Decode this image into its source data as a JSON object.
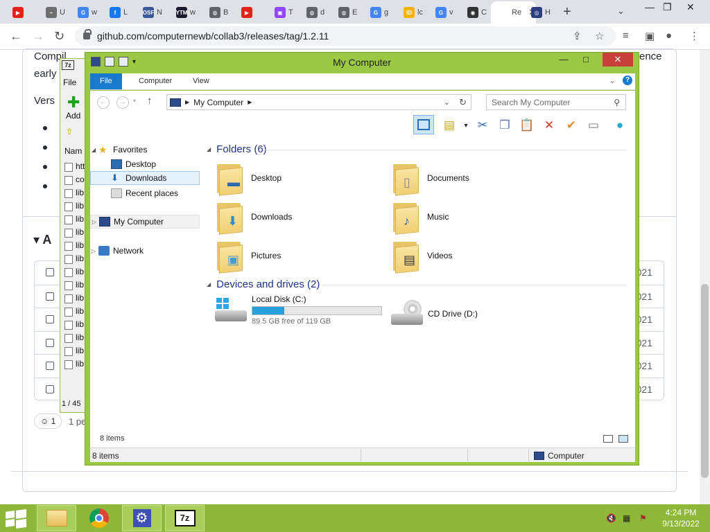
{
  "browser": {
    "tabs": [
      {
        "label": "",
        "color": "#e62117",
        "glyph": "▶"
      },
      {
        "label": "U",
        "color": "#6d6d6d",
        "glyph": "⌁"
      },
      {
        "label": "w",
        "color": "#4285f4",
        "glyph": "G"
      },
      {
        "label": "L",
        "color": "#1877f2",
        "glyph": "f"
      },
      {
        "label": "N",
        "color": "#3b5998",
        "glyph": "OSF"
      },
      {
        "label": "w",
        "color": "#1a1a2e",
        "glyph": "YTM"
      },
      {
        "label": "B",
        "color": "#5f6368",
        "glyph": "◍"
      },
      {
        "label": "",
        "color": "#e62117",
        "glyph": "▶"
      },
      {
        "label": "T",
        "color": "#9146ff",
        "glyph": "▣"
      },
      {
        "label": "d",
        "color": "#5f6368",
        "glyph": "◍"
      },
      {
        "label": "E",
        "color": "#5f6368",
        "glyph": "◍"
      },
      {
        "label": "g",
        "color": "#4285f4",
        "glyph": "G"
      },
      {
        "label": "lc",
        "color": "#f4b400",
        "glyph": "ID"
      },
      {
        "label": "v",
        "color": "#4285f4",
        "glyph": "G"
      },
      {
        "label": "C",
        "color": "#333333",
        "glyph": "◉"
      },
      {
        "label": "Re",
        "color": "#ffffff",
        "glyph": ""
      },
      {
        "label": "H",
        "color": "#2c3e80",
        "glyph": "◎"
      }
    ],
    "active_tab_index": 15,
    "new_tab": "+",
    "url": "github.com/computernewb/collab3/releases/tag/1.2.11"
  },
  "github": {
    "line1_start": "Compil",
    "line1_end": "ence",
    "line2": "early",
    "version_label": "Vers",
    "assets_label": "A",
    "asset_years": [
      "021",
      "021",
      "021",
      "021",
      "021",
      "021"
    ],
    "reaction": "1",
    "reaction_text": "1 pe"
  },
  "sevenzip": {
    "logo": "7z",
    "menu_file": "File",
    "add_label": "Add",
    "name_col": "Nam",
    "files": [
      "htt",
      "co",
      "lib",
      "lib",
      "lib",
      "lib",
      "lib",
      "lib",
      "lib",
      "lib",
      "lib",
      "lib",
      "lib",
      "lib",
      "lib",
      "lib"
    ],
    "status": "1 / 45"
  },
  "explorer": {
    "title": "My Computer",
    "ribbon_tabs": [
      "File",
      "Computer",
      "View"
    ],
    "address": "My Computer",
    "search_placeholder": "Search My Computer",
    "nav": {
      "favorites": "Favorites",
      "desktop": "Desktop",
      "downloads": "Downloads",
      "recent": "Recent places",
      "mycomputer": "My Computer",
      "network": "Network"
    },
    "folders_header": "Folders (6)",
    "folders": [
      "Desktop",
      "Documents",
      "Downloads",
      "Music",
      "Pictures",
      "Videos"
    ],
    "drives_header": "Devices and drives (2)",
    "drive_c": {
      "name": "Local Disk (C:)",
      "free": "89.5 GB free of 119 GB",
      "used_fraction": 0.248
    },
    "drive_d": {
      "name": "CD Drive (D:)"
    },
    "item_count": "8 items",
    "status_left": "8 items",
    "status_right": "Computer"
  },
  "taskbar": {
    "time": "4:24 PM",
    "date": "9/13/2022",
    "sevenzip_label": "7z"
  },
  "colors": {
    "accent_green": "#9bc943",
    "ribbon_blue": "#1979ca",
    "close_red": "#c7403a",
    "header_blue": "#1e3287"
  }
}
